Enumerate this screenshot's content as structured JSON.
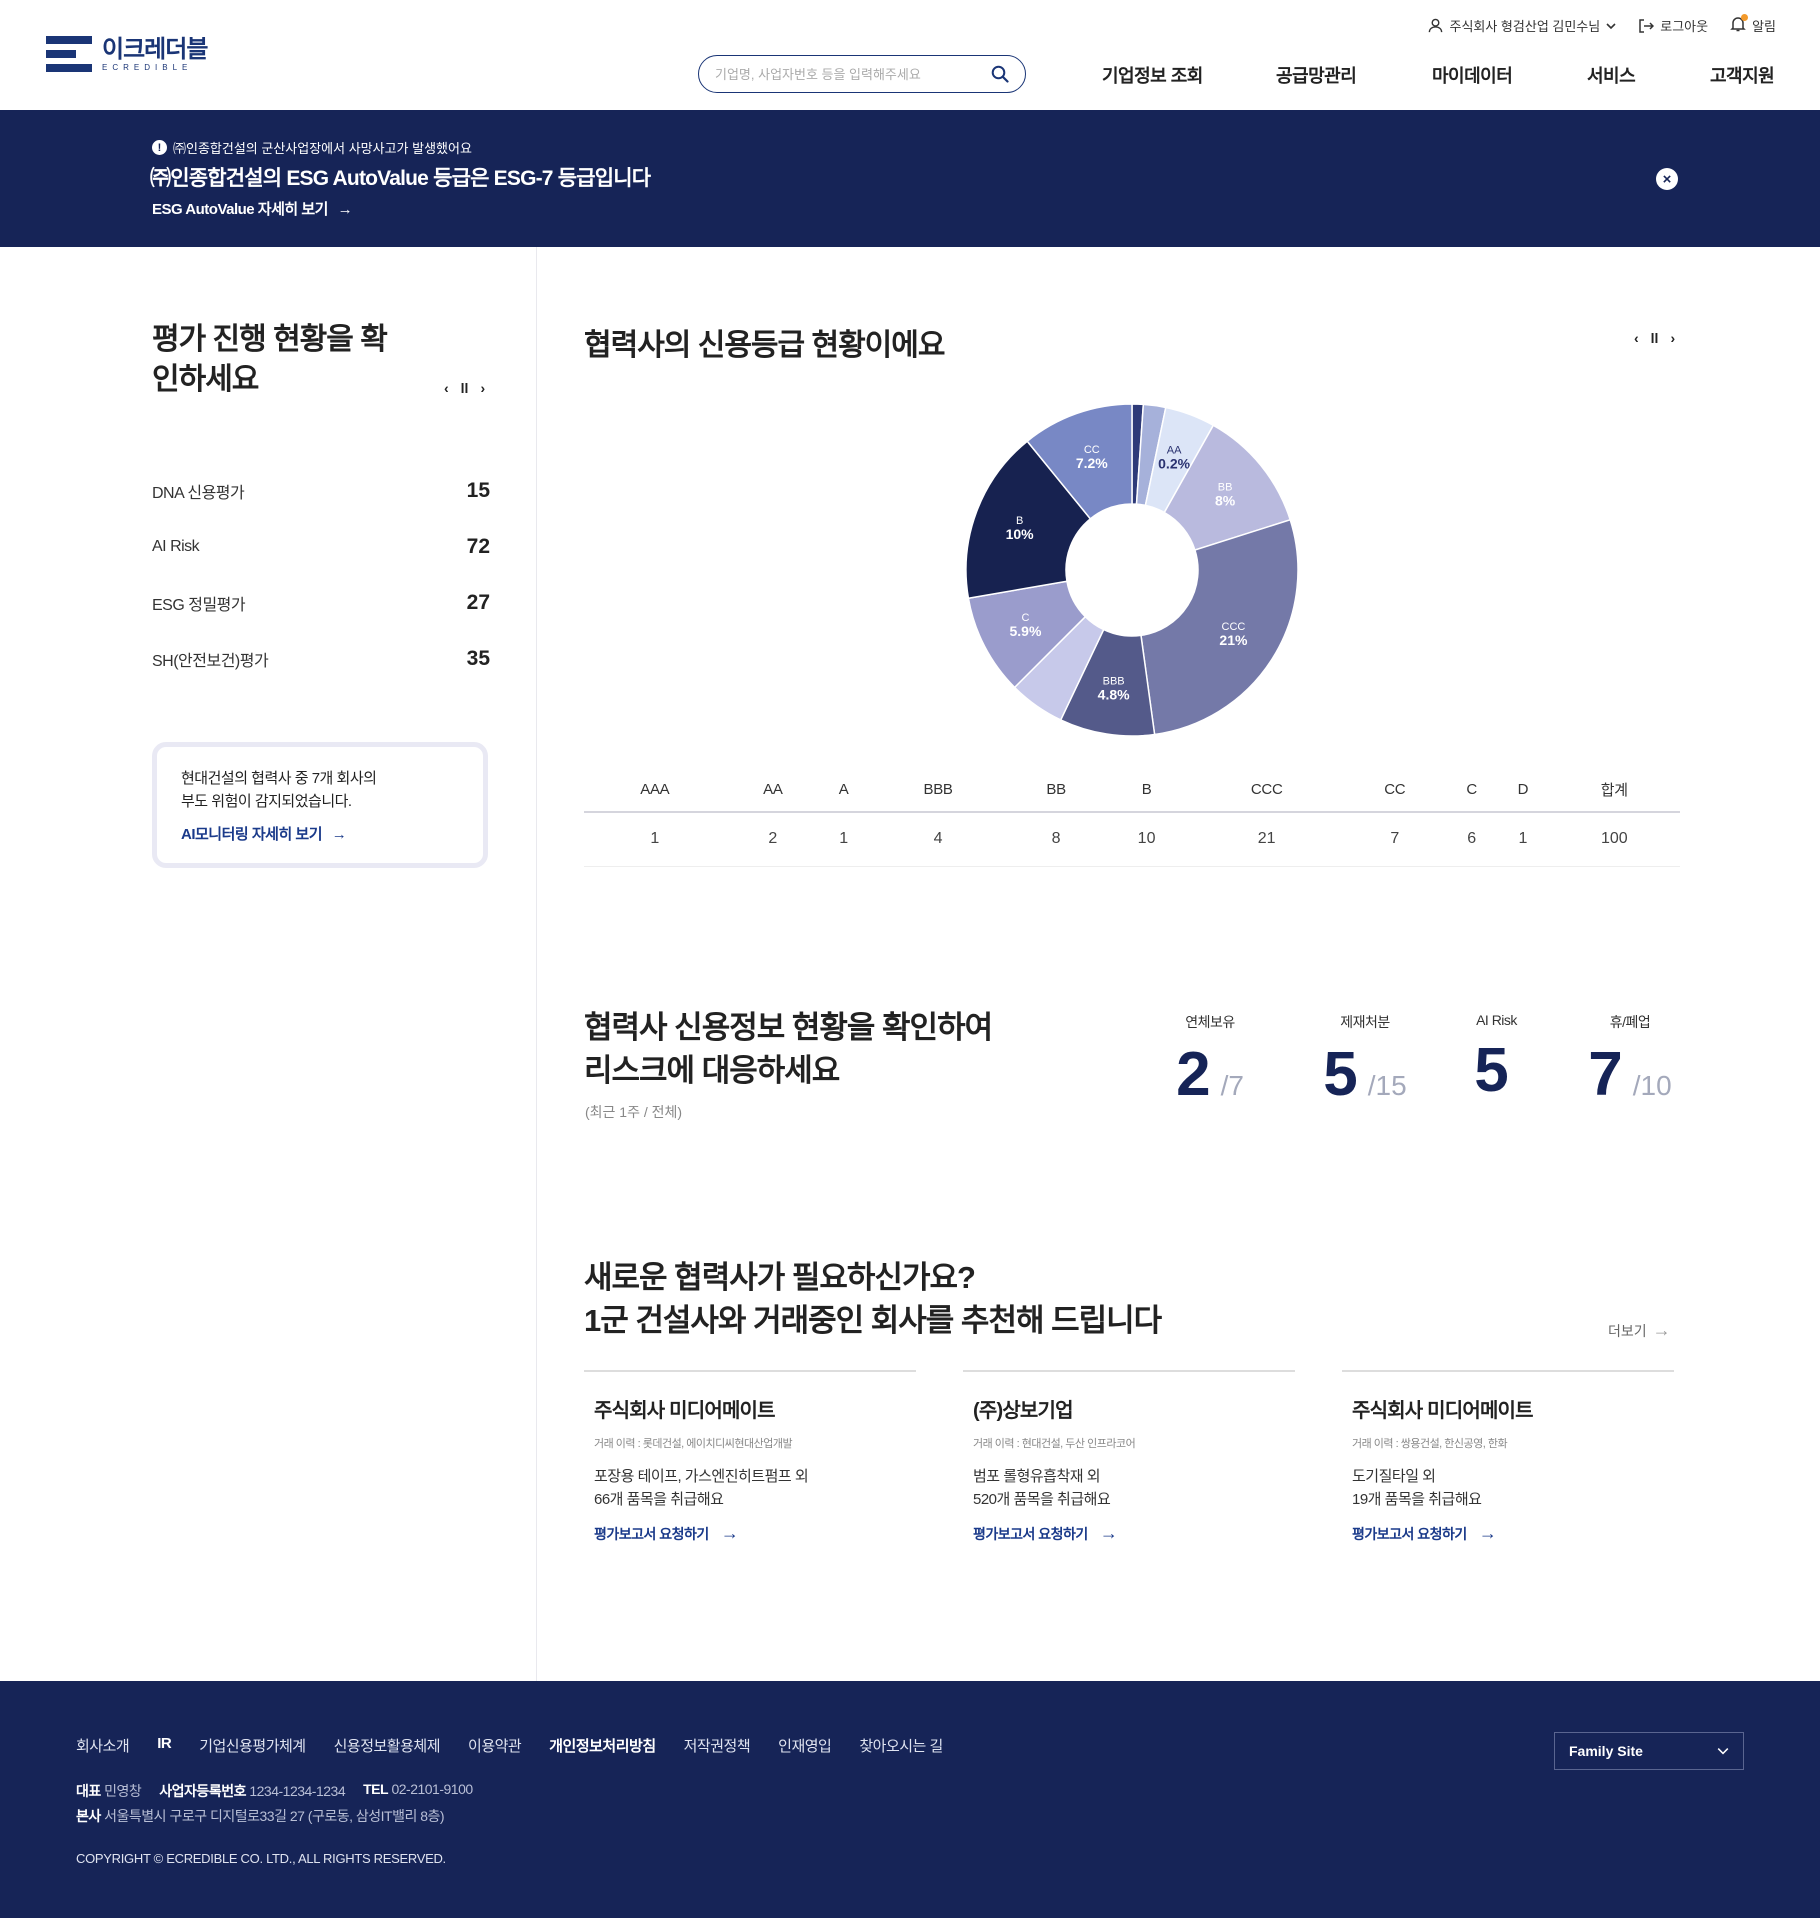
{
  "header": {
    "logo_kr": "이크레더블",
    "logo_en": "ECREDIBLE",
    "user_label": "주식회사 형검산업 김민수님",
    "logout_label": "로그아웃",
    "alert_label": "알림",
    "search_placeholder": "기업명, 사업자번호 등을 입력해주세요",
    "nav": [
      "기업정보 조회",
      "공급망관리",
      "마이데이터",
      "서비스",
      "고객지원"
    ]
  },
  "banner": {
    "notice": "㈜인종합건설의 군산사업장에서 사망사고가 발생했어요",
    "title": "㈜인종합건설의 ESG AutoValue 등급은 ESG-7 등급입니다",
    "link": "ESG AutoValue 자세히 보기"
  },
  "left": {
    "title": "평가 진행 현황을 확인하세요",
    "items": [
      {
        "label": "DNA 신용평가",
        "value": "15"
      },
      {
        "label": "AI Risk",
        "value": "72"
      },
      {
        "label": "ESG 정밀평가",
        "value": "27"
      },
      {
        "label": "SH(안전보건)평가",
        "value": "35"
      }
    ],
    "alert_text_1": "현대건설의 협력사 중 7개 회사의",
    "alert_text_2": "부도 위험이 감지되었습니다.",
    "alert_link": "AI모니터링 자세히 보기"
  },
  "chart_data": {
    "type": "pie",
    "title": "협력사의 신용등급 현황이에요",
    "slices": [
      {
        "label": "",
        "value": 1,
        "color": "#2e3a78",
        "show_label": false
      },
      {
        "label": "",
        "value": 2,
        "color": "#a6b1da",
        "show_label": false
      },
      {
        "label": "AA",
        "value": 0.2,
        "pct": "0.2%",
        "color": "#dce5f7",
        "show_label": true,
        "dark_text": true,
        "display_value": 4.5
      },
      {
        "label": "BB",
        "value": 8,
        "pct": "8%",
        "color": "#b9bade",
        "show_label": true,
        "display_value": 11
      },
      {
        "label": "CCC",
        "value": 21,
        "pct": "21%",
        "color": "#7479a8",
        "show_label": true,
        "display_value": 25.5
      },
      {
        "label": "BBB",
        "value": 4.8,
        "pct": "4.8%",
        "color": "#545a8a",
        "show_label": true,
        "display_value": 8.5
      },
      {
        "label": "",
        "value": 4,
        "color": "#c7c9ea",
        "show_label": false,
        "display_value": 5
      },
      {
        "label": "C",
        "value": 5.9,
        "pct": "5.9%",
        "color": "#9a9ccc",
        "show_label": true,
        "display_value": 9
      },
      {
        "label": "B",
        "value": 10,
        "pct": "10%",
        "color": "#172250",
        "show_label": true,
        "display_value": 15.5
      },
      {
        "label": "CC",
        "value": 7.2,
        "pct": "7.2%",
        "color": "#7888c5",
        "show_label": true,
        "display_value": 10
      }
    ],
    "table": {
      "headers": [
        "AAA",
        "AA",
        "A",
        "BBB",
        "BB",
        "B",
        "CCC",
        "CC",
        "C",
        "D",
        "합계"
      ],
      "values": [
        "1",
        "2",
        "1",
        "4",
        "8",
        "10",
        "21",
        "7",
        "6",
        "1",
        "100"
      ]
    }
  },
  "credit": {
    "title_1": "협력사 신용정보 현황을 확인하여",
    "title_2": "리스크에 대응하세요",
    "sub": "(최근 1주 / 전체)",
    "stats": [
      {
        "label": "연체보유",
        "value": "2",
        "total": "/7"
      },
      {
        "label": "제재처분",
        "value": "5",
        "total": "/15"
      },
      {
        "label": "AI Risk",
        "value": "5",
        "total": ""
      },
      {
        "label": "휴/폐업",
        "value": "7",
        "total": "/10"
      }
    ]
  },
  "recommend": {
    "title_1": "새로운 협력사가 필요하신가요?",
    "title_2": "1군 건설사와 거래중인 회사를 추천해 드립니다",
    "more": "더보기",
    "cards": [
      {
        "name": "주식회사 미디어메이트",
        "history": "거래 이력 : 롯데건설, 에이치디씨현대산업개발",
        "desc_1": "포장용 테이프, 가스엔진히트펌프 외",
        "desc_2": "66개 품목을 취급해요",
        "link": "평가보고서 요청하기"
      },
      {
        "name": "(주)상보기업",
        "history": "거래 이력 : 현대건설, 두산 인프라코어",
        "desc_1": "범포 롤형유흡착재 외",
        "desc_2": "520개 품목을 취급해요",
        "link": "평가보고서 요청하기"
      },
      {
        "name": "주식회사 미디어메이트",
        "history": "거래 이력 : 쌍용건설, 한신공영, 한화",
        "desc_1": "도기질타일 외",
        "desc_2": "19개 품목을 취급해요",
        "link": "평가보고서 요청하기"
      }
    ]
  },
  "footer": {
    "links": [
      "회사소개",
      "IR",
      "기업신용평가체계",
      "신용정보활용체제",
      "이용약관",
      "개인정보처리방침",
      "저작권정책",
      "인재영입",
      "찾아오시는 길"
    ],
    "ceo_label": "대표",
    "ceo": "민영창",
    "biz_label": "사업자등록번호",
    "biz": "1234-1234-1234",
    "tel_label": "TEL",
    "tel": "02-2101-9100",
    "addr_label": "본사",
    "addr": "서울특별시 구로구 디지털로33길 27 (구로동, 삼성IT밸리 8층)",
    "copyright": "COPYRIGHT © ECREDIBLE CO. LTD., ALL RIGHTS RESERVED.",
    "family_site": "Family Site"
  }
}
